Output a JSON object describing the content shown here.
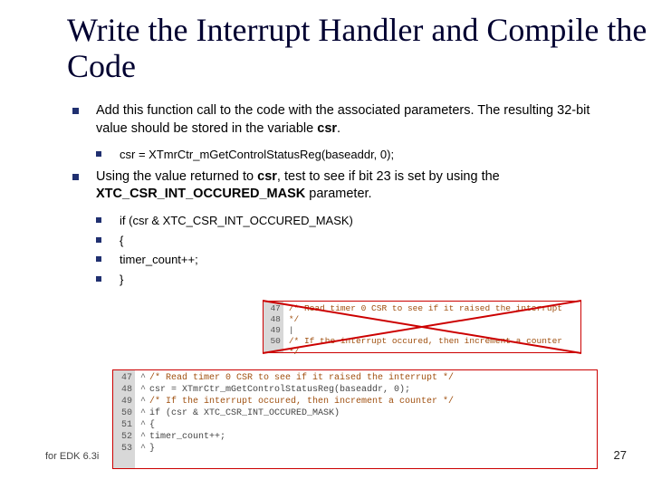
{
  "title": "Write the Interrupt Handler and Compile the Code",
  "bullets": {
    "p1": "Add this function call to the code with the associated parameters. The resulting 32-bit value should be stored in the variable ",
    "p1_bold": "csr",
    "p1_end": ".",
    "code1": "csr = XTmrCtr_mGetControlStatusReg(baseaddr, 0);",
    "p2a": "Using the value returned to ",
    "p2b": "csr",
    "p2c": ", test to see if bit 23 is set by using the ",
    "p2d": "XTC_CSR_INT_OCCURED_MASK",
    "p2e": " parameter.",
    "code2a": "if (csr & XTC_CSR_INT_OCCURED_MASK)",
    "code2b": "{",
    "code2c": "timer_count++;",
    "code2d": "}"
  },
  "inset_small": {
    "lines": [
      "47",
      "48",
      "49",
      "50"
    ],
    "code": [
      {
        "t": "/* Read timer 0 CSR to see if it raised the interrupt */",
        "c": true
      },
      {
        "t": "|",
        "c": false
      },
      {
        "t": "/* If the interrupt occured, then increment a counter */",
        "c": true
      },
      {
        "t": "",
        "c": false
      }
    ]
  },
  "inset_large": {
    "lines": [
      "47",
      "48",
      "49",
      "50",
      "51",
      "52",
      "53"
    ],
    "code": [
      {
        "t": "/* Read timer 0 CSR to see if it raised the interrupt */",
        "c": true
      },
      {
        "t": "csr = XTmrCtr_mGetControlStatusReg(baseaddr, 0);",
        "c": false
      },
      {
        "t": "/* If the interrupt occured, then increment a counter */",
        "c": true
      },
      {
        "t": "if (csr & XTC_CSR_INT_OCCURED_MASK)",
        "c": false
      },
      {
        "t": "{",
        "c": false
      },
      {
        "t": "    timer_count++;",
        "c": false
      },
      {
        "t": "}",
        "c": false
      }
    ]
  },
  "footer": "for EDK 6.3i",
  "page": "27"
}
